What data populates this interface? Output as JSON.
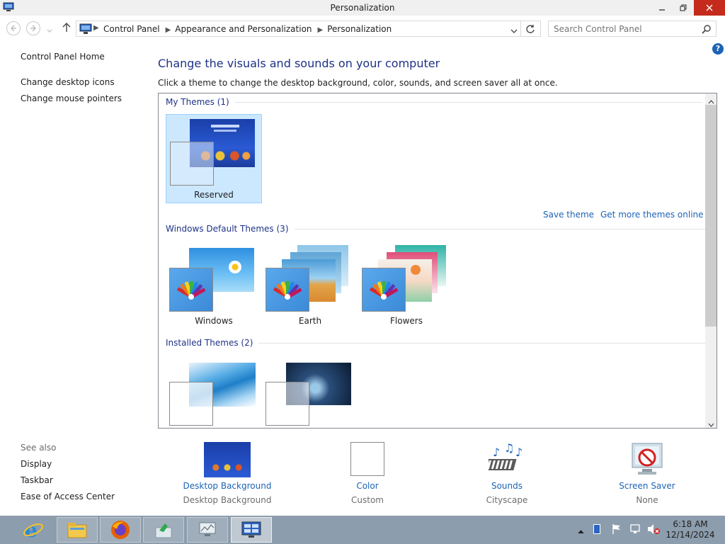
{
  "window": {
    "title": "Personalization"
  },
  "nav": {
    "breadcrumbs": [
      "Control Panel",
      "Appearance and Personalization",
      "Personalization"
    ],
    "search_placeholder": "Search Control Panel"
  },
  "left_panel": {
    "links": [
      "Control Panel Home",
      "Change desktop icons",
      "Change mouse pointers"
    ],
    "see_also_label": "See also",
    "see_also": [
      "Display",
      "Taskbar",
      "Ease of Access Center"
    ]
  },
  "main": {
    "heading": "Change the visuals and sounds on your computer",
    "subheading": "Click a theme to change the desktop background, color, sounds, and screen saver all at once.",
    "groups": {
      "my_themes": {
        "title": "My Themes (1)",
        "items": [
          "Reserved"
        ]
      },
      "actions": {
        "save": "Save theme",
        "get_more": "Get more themes online"
      },
      "default_themes": {
        "title": "Windows Default Themes (3)",
        "items": [
          "Windows",
          "Earth",
          "Flowers"
        ]
      },
      "installed_themes": {
        "title": "Installed Themes (2)"
      }
    }
  },
  "bottom": {
    "desktop_background": {
      "label": "Desktop Background",
      "value": "Desktop Background"
    },
    "color": {
      "label": "Color",
      "value": "Custom"
    },
    "sounds": {
      "label": "Sounds",
      "value": "Cityscape"
    },
    "screen_saver": {
      "label": "Screen Saver",
      "value": "None"
    }
  },
  "taskbar": {
    "time": "6:18 AM",
    "date": "12/14/2024"
  },
  "colors": {
    "accent_link": "#1c63b7",
    "heading": "#1e3287",
    "close_button": "#c42b1c",
    "taskbar": "#8c9dad"
  }
}
